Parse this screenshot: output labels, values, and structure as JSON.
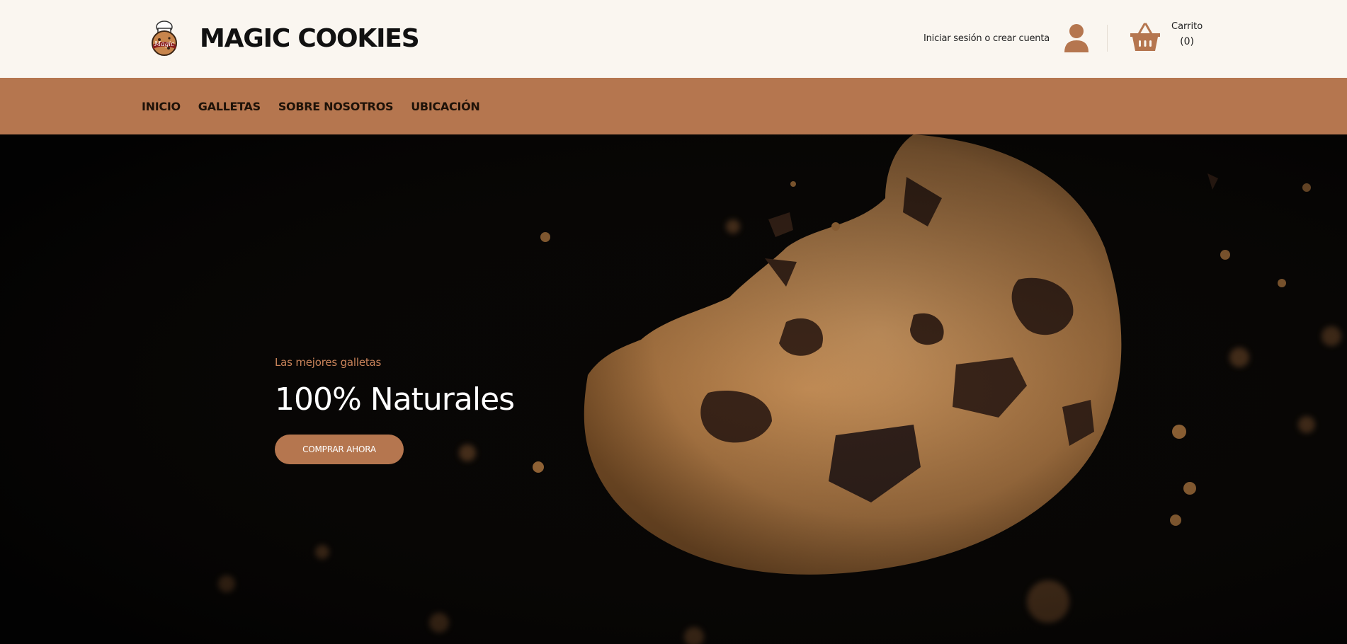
{
  "brand": {
    "title": "MAGIC COOKIES",
    "logo_text": "Magic"
  },
  "account": {
    "label": "Iniciar sesión o crear cuenta"
  },
  "cart": {
    "label": "Carrito",
    "count": "(0)"
  },
  "nav": {
    "items": [
      {
        "label": "INICIO"
      },
      {
        "label": "GALLETAS"
      },
      {
        "label": "SOBRE NOSOTROS"
      },
      {
        "label": "UBICACIÓN"
      }
    ]
  },
  "hero": {
    "subtitle": "Las mejores galletas",
    "title": "100% Naturales",
    "button_label": "COMPRAR AHORA"
  },
  "colors": {
    "accent": "#b5764f",
    "header_bg": "#faf6f0",
    "hero_bg": "#050403",
    "subtitle": "#c9835a"
  },
  "icons": [
    "brand-logo-icon",
    "user-icon",
    "basket-icon"
  ]
}
